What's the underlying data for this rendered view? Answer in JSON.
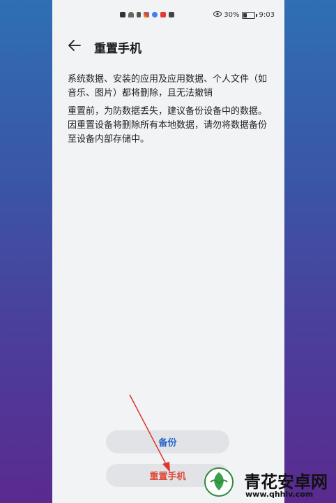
{
  "status_bar": {
    "battery_percent": "30%",
    "time": "9:03"
  },
  "header": {
    "title": "重置手机",
    "back_icon": "back-arrow-icon"
  },
  "content": {
    "paragraph_1": "系统数据、安装的应用及应用数据、个人文件（如音乐、图片）都将删除，且无法撤销",
    "paragraph_2": "重置前，为防数据丢失，建议备份设备中的数据。因重置设备将删除所有本地数据，请勿将数据备份至设备内部存储中。"
  },
  "buttons": {
    "backup_label": "备份",
    "reset_label": "重置手机"
  },
  "watermark": {
    "title": "青花安卓网",
    "url": "www.qhhlv.com"
  },
  "colors": {
    "backup_text": "#2563c9",
    "reset_text": "#e04a3a",
    "annotation_arrow": "#e0352b"
  }
}
